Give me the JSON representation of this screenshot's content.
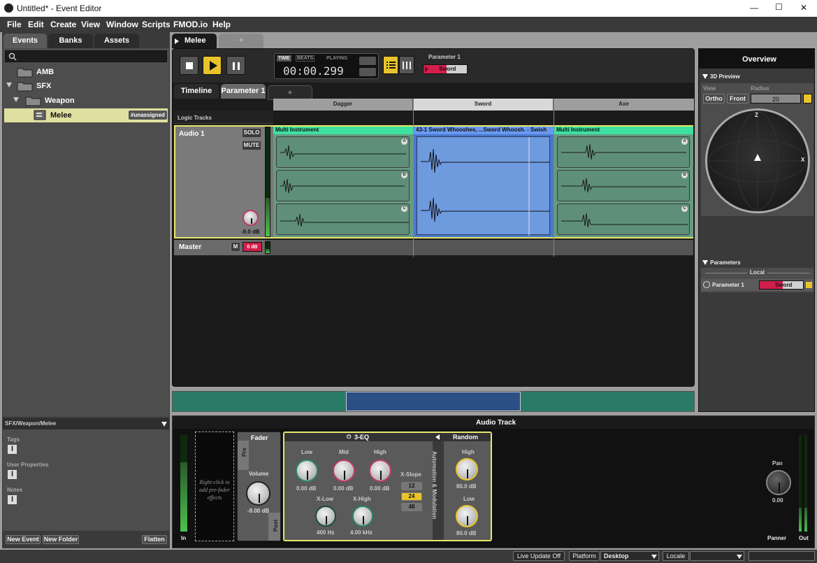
{
  "window": {
    "title": "Untitled* - Event Editor",
    "controls": [
      "—",
      "☐",
      "✕"
    ]
  },
  "menu": [
    "File",
    "Edit",
    "Create",
    "View",
    "Window",
    "Scripts",
    "FMOD.io",
    "Help"
  ],
  "browser": {
    "tabs": [
      "Events",
      "Banks",
      "Assets"
    ],
    "search_placeholder": "",
    "tree": [
      {
        "label": "AMB",
        "kind": "folder"
      },
      {
        "label": "SFX",
        "kind": "folder"
      },
      {
        "label": "Weapon",
        "kind": "folder"
      },
      {
        "label": "Melee",
        "kind": "event",
        "badge": "#unassigned"
      }
    ],
    "path": "SFX/Weapon/Melee",
    "props": [
      "Tags",
      "User Properties",
      "Notes"
    ],
    "buttons": [
      "New Event",
      "New Folder",
      "Flatten"
    ]
  },
  "editor": {
    "event_tab": "Melee",
    "transport": {
      "time": "TIME",
      "beats": "BEATS",
      "status": "PLAYING",
      "timecode": "00:00.299"
    },
    "param_header": "Parameter 1",
    "param_value": "Sword",
    "subtabs": [
      "Timeline",
      "Parameter 1",
      "+"
    ],
    "ruler": [
      "Dagger",
      "Sword",
      "Axe"
    ],
    "logic_tracks": "Logic Tracks",
    "track": {
      "name": "Audio 1",
      "solo": "SOLO",
      "mute": "MUTE",
      "volume": "-9.0 dB"
    },
    "master": {
      "name": "Master",
      "m": "M",
      "vol": "0 dB"
    },
    "instruments": [
      {
        "title": "Multi Instrument",
        "letters": [
          "A",
          "B",
          "C"
        ]
      },
      {
        "title": "43-1 Sword Whooshes, ...Sword Whoosh. - Swish"
      },
      {
        "title": "Multi Instrument",
        "letters": [
          "A",
          "B",
          "C"
        ]
      }
    ]
  },
  "overview": {
    "title": "Overview",
    "preview": "3D Preview",
    "view_label": "View",
    "radius_label": "Radius",
    "ortho": "Ortho",
    "front": "Front",
    "radius": "20",
    "z": "Z",
    "x": "X",
    "parameters": "Parameters",
    "local": "Local",
    "param_name": "Parameter 1",
    "param_value": "Sword"
  },
  "deck": {
    "title": "Audio Track",
    "in_label": "In",
    "empty_slot": "Right-click to add pre-fader effects",
    "fader": {
      "title": "Fader",
      "pre": "Pre",
      "post": "Post",
      "volume_label": "Volume",
      "volume": "-9.00 dB"
    },
    "eq": {
      "title": "3-EQ",
      "low": "Low",
      "mid": "Mid",
      "high": "High",
      "low_val": "0.00 dB",
      "mid_val": "0.00 dB",
      "high_val": "0.00 dB",
      "xlow": "X-Low",
      "xhigh": "X-High",
      "xlow_val": "400 Hz",
      "xhigh_val": "4.00 kHz",
      "slope": "X-Slope",
      "slopes": [
        "12",
        "24",
        "48"
      ]
    },
    "automation": "Automation & Modulation",
    "random": {
      "title": "Random",
      "high": "High",
      "high_val": "80.0 dB",
      "low": "Low",
      "low_val": "80.0 dB"
    },
    "pan": {
      "label": "Pan",
      "value": "0.00"
    },
    "panner": "Panner",
    "out": "Out"
  },
  "status": {
    "live": "Live Update Off",
    "platform_label": "Platform",
    "platform": "Desktop",
    "locale_label": "Locale",
    "locale": ""
  }
}
